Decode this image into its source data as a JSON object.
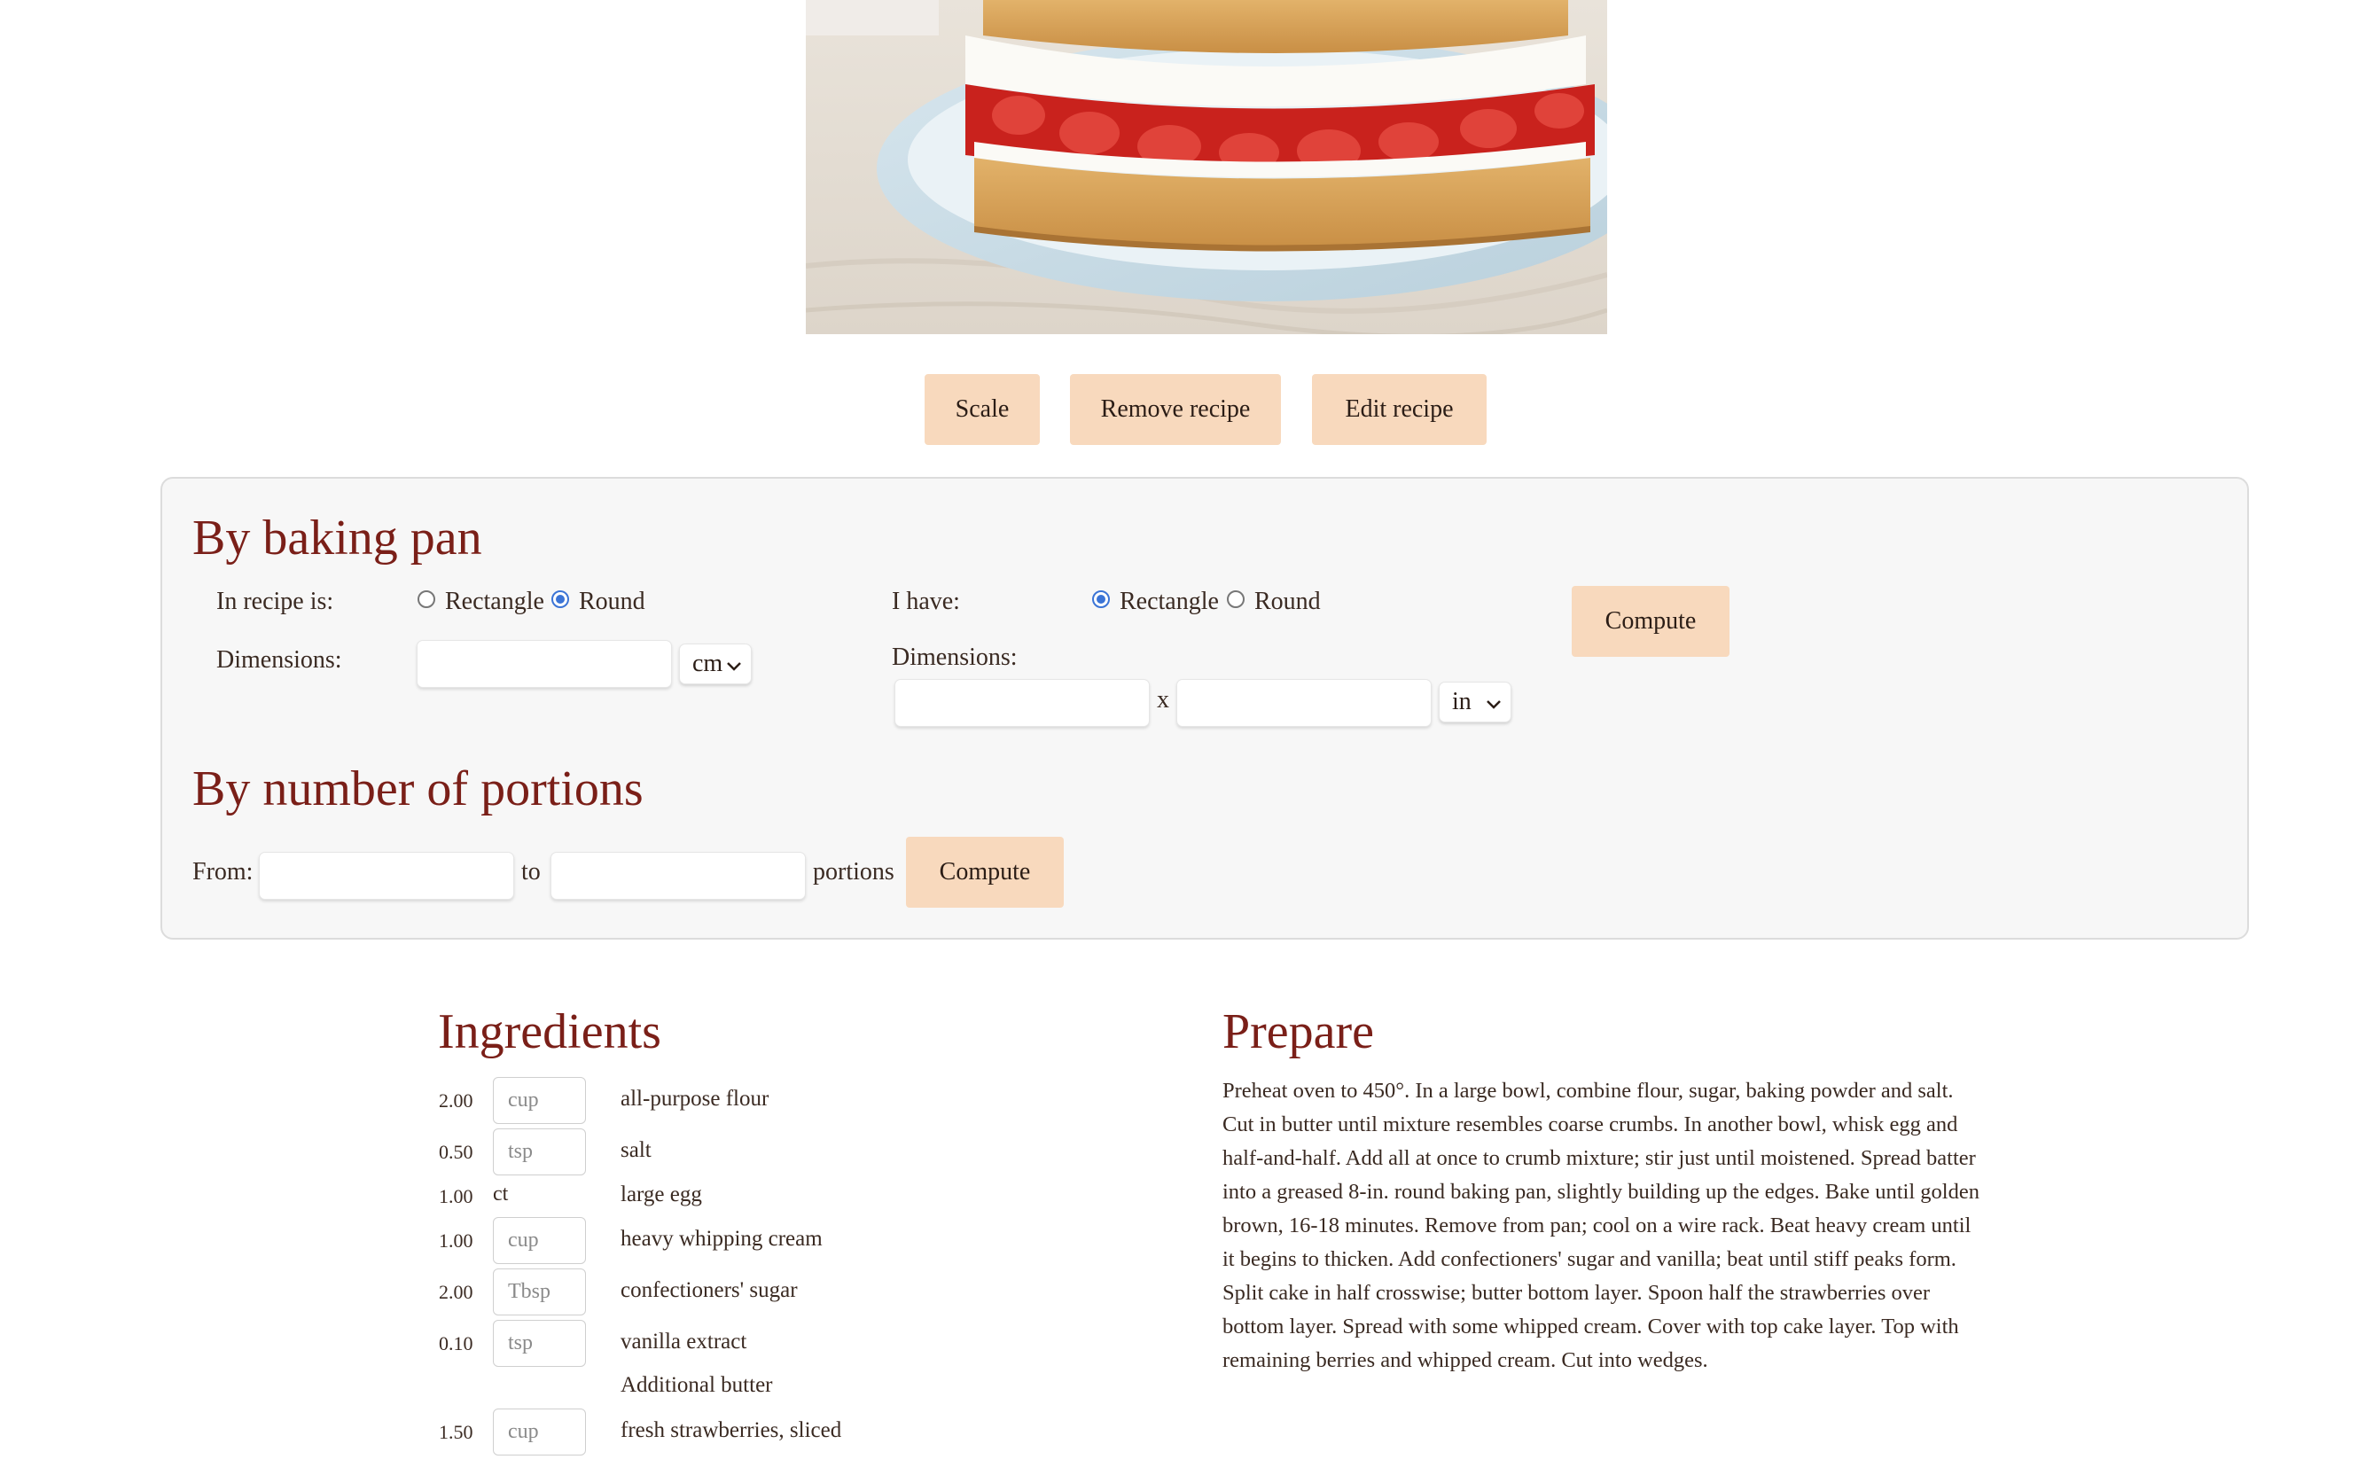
{
  "actions": {
    "scale_label": "Scale",
    "remove_label": "Remove recipe",
    "edit_label": "Edit recipe"
  },
  "by_pan": {
    "title": "By baking pan",
    "recipe_label": "In recipe is:",
    "recipe_shape_options": [
      "Rectangle",
      "Round"
    ],
    "recipe_shape_selected": "Round",
    "recipe_dimensions_label": "Dimensions:",
    "recipe_unit": "cm",
    "have_label": "I have:",
    "have_shape_options": [
      "Rectangle",
      "Round"
    ],
    "have_shape_selected": "Rectangle",
    "have_dimensions_label": "Dimensions:",
    "times": "x",
    "have_unit": "in",
    "compute_label": "Compute"
  },
  "by_portions": {
    "title": "By number of portions",
    "from_label": "From:",
    "to_label": "to",
    "portions_label": "portions",
    "compute_label": "Compute"
  },
  "ingredients": {
    "title": "Ingredients",
    "items": [
      {
        "qty": "2.00",
        "unit": "cup",
        "unit_editable": true,
        "name": "all-purpose flour"
      },
      {
        "qty": "0.50",
        "unit": "tsp",
        "unit_editable": true,
        "name": "salt"
      },
      {
        "qty": "1.00",
        "unit": "ct",
        "unit_editable": false,
        "name": "large egg"
      },
      {
        "qty": "1.00",
        "unit": "cup",
        "unit_editable": true,
        "name": "heavy whipping cream"
      },
      {
        "qty": "2.00",
        "unit": "Tbsp",
        "unit_editable": true,
        "name": "confectioners' sugar"
      },
      {
        "qty": "0.10",
        "unit": "tsp",
        "unit_editable": true,
        "name": "vanilla extract"
      },
      {
        "qty": "",
        "unit": "",
        "unit_editable": false,
        "name": "Additional butter"
      },
      {
        "qty": "1.50",
        "unit": "cup",
        "unit_editable": true,
        "name": "fresh strawberries, sliced"
      }
    ]
  },
  "prepare": {
    "title": "Prepare",
    "text": "Preheat oven to 450°. In a large bowl, combine flour, sugar, baking powder and salt. Cut in butter until mixture resembles coarse crumbs. In another bowl, whisk egg and half-and-half. Add all at once to crumb mixture; stir just until moistened. Spread batter into a greased 8-in. round baking pan, slightly building up the edges. Bake until golden brown, 16-18 minutes. Remove from pan; cool on a wire rack. Beat heavy cream until it begins to thicken. Add confectioners' sugar and vanilla; beat until stiff peaks form. Split cake in half crosswise; butter bottom layer. Spoon half the strawberries over bottom layer. Spread with some whipped cream. Cover with top cake layer. Top with remaining berries and whipped cream. Cut into wedges."
  },
  "colors": {
    "heading": "#7a1f18",
    "button_bg": "#f8d9bd",
    "panel_bg": "#f7f7f7",
    "radio_selected": "#3b74d6"
  }
}
